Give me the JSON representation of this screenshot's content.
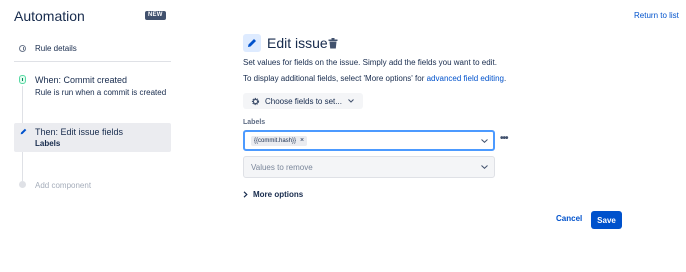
{
  "app": {
    "title": "Automation",
    "badge": "NEW",
    "return_link": "Return to list"
  },
  "sidebar": {
    "rule_details": "Rule details",
    "trigger": {
      "title": "When: Commit created",
      "description": "Rule is run when a commit is created"
    },
    "action": {
      "title": "Then: Edit issue fields",
      "subtitle": "Labels"
    },
    "add_component": "Add component"
  },
  "editor": {
    "title": "Edit issue",
    "description": "Set values for fields on the issue. Simply add the fields you want to edit.",
    "additional_prefix": "To display additional fields, select 'More options' for ",
    "additional_link": "advanced field editing",
    "additional_suffix": ".",
    "choose_fields_label": "Choose fields to set...",
    "labels_caption": "Labels",
    "labels_tags": [
      "{{commit.hash}}"
    ],
    "values_to_remove_placeholder": "Values to remove",
    "more_options_label": "More options",
    "cancel_label": "Cancel",
    "save_label": "Save"
  },
  "colors": {
    "primary": "#0052cc",
    "focus_border": "#4c9aff",
    "trigger_green": "#00875a",
    "selected_bg": "#ebecf0"
  },
  "icons": [
    "info-icon",
    "commit-trigger-icon",
    "pencil-icon",
    "trash-icon",
    "gear-icon",
    "chevron-down-icon",
    "chevron-right-icon",
    "more-icon"
  ]
}
